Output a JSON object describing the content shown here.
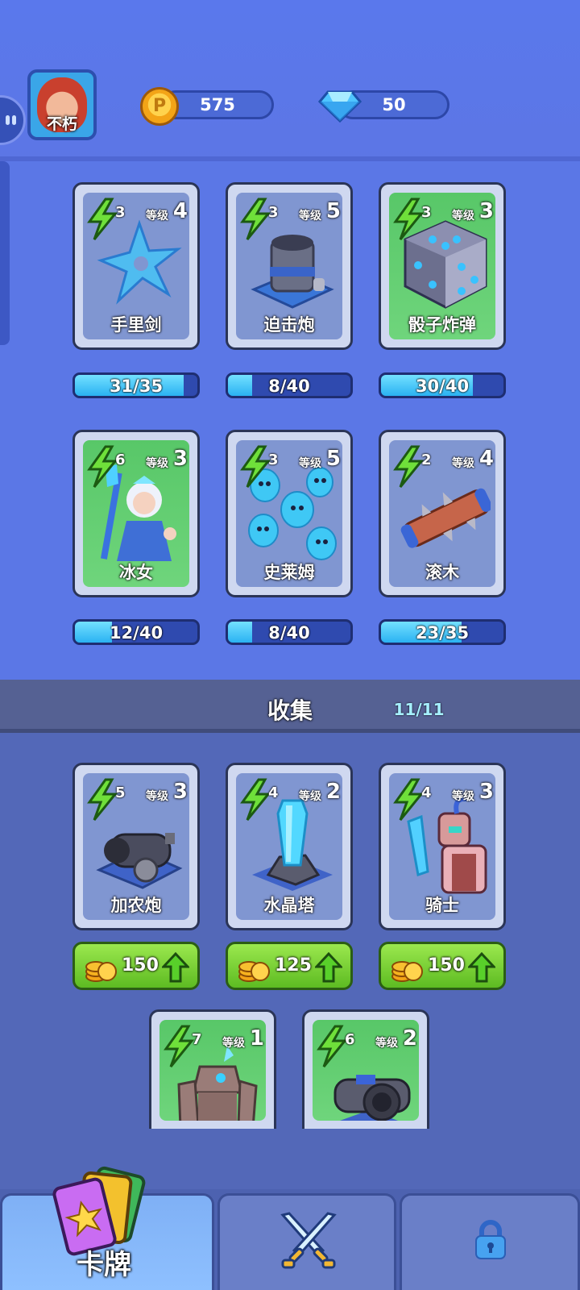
{
  "player": {
    "name": "不朽"
  },
  "currency": {
    "coins": "575",
    "gems": "50"
  },
  "level_label": "等级",
  "deck": [
    {
      "name": "手里剑",
      "cost": "3",
      "level": "4",
      "progress": "31/35",
      "fraction": 0.886,
      "bg": "blue"
    },
    {
      "name": "迫击炮",
      "cost": "3",
      "level": "5",
      "progress": "8/40",
      "fraction": 0.2,
      "bg": "blue"
    },
    {
      "name": "骰子炸弹",
      "cost": "3",
      "level": "3",
      "progress": "30/40",
      "fraction": 0.75,
      "bg": "green"
    },
    {
      "name": "冰女",
      "cost": "6",
      "level": "3",
      "progress": "12/40",
      "fraction": 0.3,
      "bg": "green"
    },
    {
      "name": "史莱姆",
      "cost": "3",
      "level": "5",
      "progress": "8/40",
      "fraction": 0.2,
      "bg": "blue"
    },
    {
      "name": "滚木",
      "cost": "2",
      "level": "4",
      "progress": "23/35",
      "fraction": 0.657,
      "bg": "blue"
    }
  ],
  "collection": {
    "title": "收集",
    "count": "11/11",
    "cards": [
      {
        "name": "加农炮",
        "cost": "5",
        "level": "3",
        "price": "150",
        "bg": "blue"
      },
      {
        "name": "水晶塔",
        "cost": "4",
        "level": "2",
        "price": "125",
        "bg": "blue"
      },
      {
        "name": "骑士",
        "cost": "4",
        "level": "3",
        "price": "150",
        "bg": "blue"
      },
      {
        "name": "",
        "cost": "7",
        "level": "1",
        "bg": "green"
      },
      {
        "name": "",
        "cost": "6",
        "level": "2",
        "bg": "green"
      }
    ]
  },
  "nav": {
    "cards_label": "卡牌",
    "tabs": [
      "cards",
      "battle",
      "locked"
    ]
  }
}
